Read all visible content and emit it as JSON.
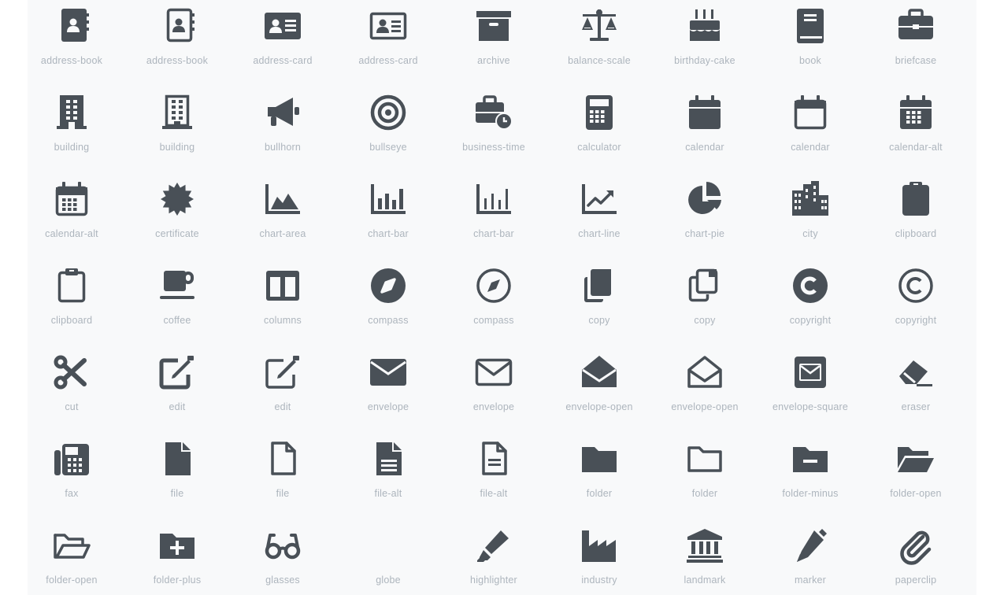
{
  "colors": {
    "icon": "#495057",
    "label": "#adb5bd",
    "panel": "#f8f9fa"
  },
  "icons": [
    {
      "name": "address-book",
      "style": "solid"
    },
    {
      "name": "address-book",
      "style": "regular"
    },
    {
      "name": "address-card",
      "style": "solid"
    },
    {
      "name": "address-card",
      "style": "regular"
    },
    {
      "name": "archive",
      "style": "solid"
    },
    {
      "name": "balance-scale",
      "style": "solid"
    },
    {
      "name": "birthday-cake",
      "style": "solid"
    },
    {
      "name": "book",
      "style": "solid"
    },
    {
      "name": "briefcase",
      "style": "solid"
    },
    {
      "name": "building",
      "style": "solid"
    },
    {
      "name": "building",
      "style": "regular"
    },
    {
      "name": "bullhorn",
      "style": "solid"
    },
    {
      "name": "bullseye",
      "style": "solid"
    },
    {
      "name": "business-time",
      "style": "solid"
    },
    {
      "name": "calculator",
      "style": "solid"
    },
    {
      "name": "calendar",
      "style": "solid"
    },
    {
      "name": "calendar",
      "style": "regular"
    },
    {
      "name": "calendar-alt",
      "style": "solid"
    },
    {
      "name": "calendar-alt",
      "style": "regular"
    },
    {
      "name": "certificate",
      "style": "solid"
    },
    {
      "name": "chart-area",
      "style": "solid"
    },
    {
      "name": "chart-bar",
      "style": "solid"
    },
    {
      "name": "chart-bar",
      "style": "regular"
    },
    {
      "name": "chart-line",
      "style": "solid"
    },
    {
      "name": "chart-pie",
      "style": "solid"
    },
    {
      "name": "city",
      "style": "solid"
    },
    {
      "name": "clipboard",
      "style": "solid"
    },
    {
      "name": "clipboard",
      "style": "regular"
    },
    {
      "name": "coffee",
      "style": "solid"
    },
    {
      "name": "columns",
      "style": "solid"
    },
    {
      "name": "compass",
      "style": "solid"
    },
    {
      "name": "compass",
      "style": "regular"
    },
    {
      "name": "copy",
      "style": "solid"
    },
    {
      "name": "copy",
      "style": "regular"
    },
    {
      "name": "copyright",
      "style": "solid"
    },
    {
      "name": "copyright",
      "style": "regular"
    },
    {
      "name": "cut",
      "style": "solid"
    },
    {
      "name": "edit",
      "style": "solid"
    },
    {
      "name": "edit",
      "style": "regular"
    },
    {
      "name": "envelope",
      "style": "solid"
    },
    {
      "name": "envelope",
      "style": "regular"
    },
    {
      "name": "envelope-open",
      "style": "solid"
    },
    {
      "name": "envelope-open",
      "style": "regular"
    },
    {
      "name": "envelope-square",
      "style": "solid"
    },
    {
      "name": "eraser",
      "style": "solid"
    },
    {
      "name": "fax",
      "style": "solid"
    },
    {
      "name": "file",
      "style": "solid"
    },
    {
      "name": "file",
      "style": "regular"
    },
    {
      "name": "file-alt",
      "style": "solid"
    },
    {
      "name": "file-alt",
      "style": "regular"
    },
    {
      "name": "folder",
      "style": "solid"
    },
    {
      "name": "folder",
      "style": "regular"
    },
    {
      "name": "folder-minus",
      "style": "solid"
    },
    {
      "name": "folder-open",
      "style": "solid"
    },
    {
      "name": "folder-open",
      "style": "regular"
    },
    {
      "name": "folder-plus",
      "style": "solid"
    },
    {
      "name": "glasses",
      "style": "solid"
    },
    {
      "name": "globe",
      "style": "solid"
    },
    {
      "name": "highlighter",
      "style": "solid"
    },
    {
      "name": "industry",
      "style": "solid"
    },
    {
      "name": "landmark",
      "style": "solid"
    },
    {
      "name": "marker",
      "style": "solid"
    },
    {
      "name": "paperclip",
      "style": "solid"
    }
  ]
}
